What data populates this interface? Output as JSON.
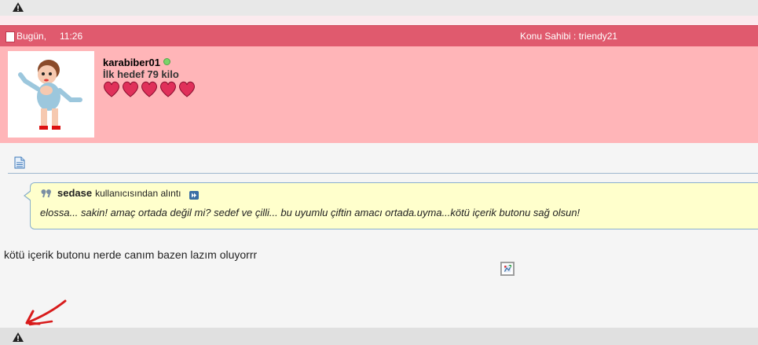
{
  "post": {
    "date": "Bugün,",
    "time": "11:26",
    "owner_label": "Konu Sahibi : triendy21"
  },
  "user": {
    "name": "karabiber01",
    "title": "İlk hedef 79 kilo",
    "status": "online",
    "reputation_hearts": 5,
    "colors": {
      "header": "#e05a6e",
      "user_bg": "#ffb5b8",
      "heart": "#e0305a"
    }
  },
  "quote": {
    "author": "sedase",
    "suffix": "kullanıcısından alıntı",
    "text": "elossa... sakin! amaç ortada değil mi? sedef ve çilli... bu uyumlu çiftin amacı ortada.uyma...kötü içerik butonu sağ olsun!"
  },
  "message": {
    "text": "kötü içerik butonu nerde canım bazen lazım oluyorrr"
  },
  "icons": {
    "top_warning": "warning-icon",
    "bottom_warning": "warning-icon",
    "post_doc": "document-icon",
    "quote": "quote-icon",
    "view_post": "view-post-arrow-icon",
    "broken_image": "broken-image-icon",
    "annotation": "red-arrow-icon"
  }
}
